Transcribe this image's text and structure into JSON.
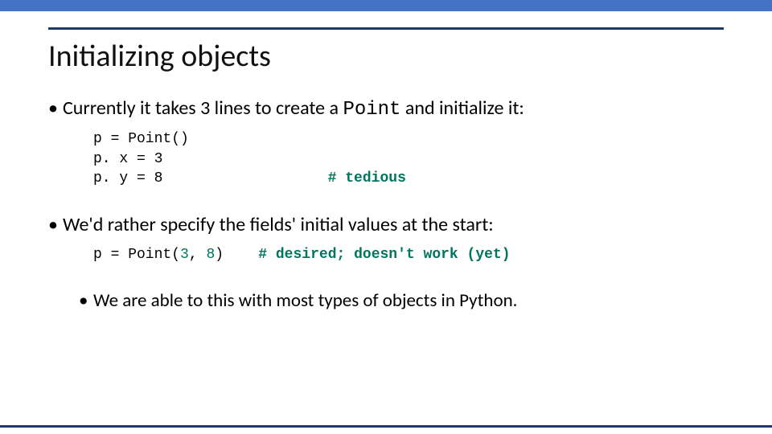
{
  "accent_bar_color": "#4472c4",
  "rule_color": "#1f3864",
  "title": "Initializing objects",
  "bullet1": {
    "pre": "Currently it takes 3 lines to create a ",
    "code_inline": "Point",
    "post": " and initialize it:"
  },
  "code1": {
    "l1": "p = Point()",
    "l2": "p. x = 3",
    "l3": "p. y = 8",
    "pad": "                   ",
    "comment": "# tedious"
  },
  "bullet2": "We'd rather specify the fields' initial values at the start:",
  "code2": {
    "pre": "p = Point(",
    "n1": "3",
    "mid": ", ",
    "n2": "8",
    "post": ")    ",
    "comment": "# desired; doesn't work (yet)"
  },
  "bullet3": "We are able to this with most types of objects in Python."
}
